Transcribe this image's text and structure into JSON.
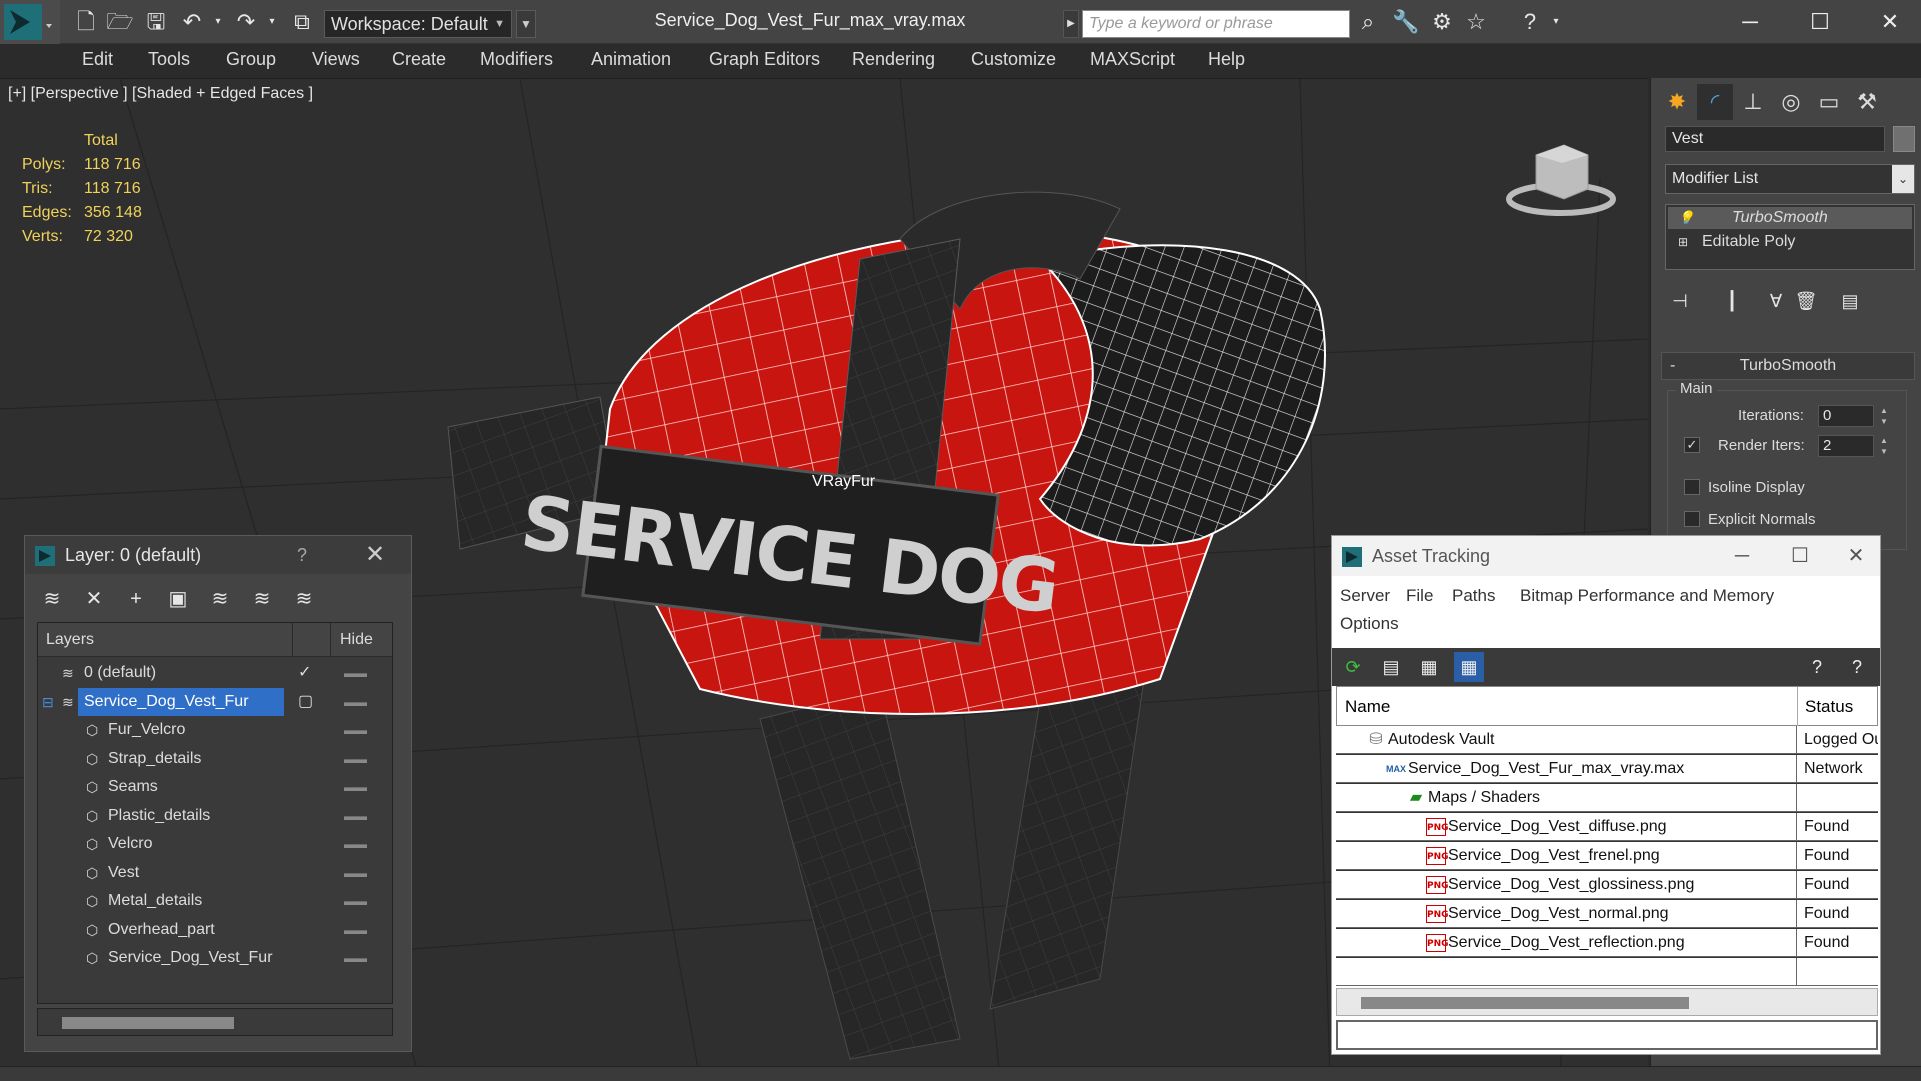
{
  "titlebar": {
    "workspace_label": "Workspace: Default",
    "document_title": "Service_Dog_Vest_Fur_max_vray.max",
    "search_placeholder": "Type a keyword or phrase"
  },
  "menu": [
    "Edit",
    "Tools",
    "Group",
    "Views",
    "Create",
    "Modifiers",
    "Animation",
    "Graph Editors",
    "Rendering",
    "Customize",
    "MAXScript",
    "Help"
  ],
  "viewport": {
    "label": "[+] [Perspective ] [Shaded + Edged Faces ]",
    "stats_header": "Total",
    "stats": [
      {
        "label": "Polys:",
        "value": "118 716"
      },
      {
        "label": "Tris:",
        "value": "118 716"
      },
      {
        "label": "Edges:",
        "value": "356 148"
      },
      {
        "label": "Verts:",
        "value": "72 320"
      }
    ],
    "object_label": "VRayFur",
    "patch_text": "SERVICE DOG",
    "accent_red": "#c8150f"
  },
  "command_panel": {
    "object_name": "Vest",
    "modifier_list": "Modifier List",
    "stack": [
      "TurboSmooth",
      "Editable Poly"
    ],
    "rollout_title": "TurboSmooth",
    "main_group": "Main",
    "iterations_label": "Iterations:",
    "iterations_value": "0",
    "render_iters_label": "Render Iters:",
    "render_iters_value": "2",
    "isoline_label": "Isoline Display",
    "explicit_normals_label": "Explicit Normals"
  },
  "layer_window": {
    "title": "Layer: 0 (default)",
    "help": "?",
    "col_layers": "Layers",
    "col_hide": "Hide",
    "rows": [
      {
        "name": "0 (default)",
        "type": "layer"
      },
      {
        "name": "Service_Dog_Vest_Fur",
        "type": "layer",
        "selected": true
      },
      {
        "name": "Fur_Velcro",
        "type": "object"
      },
      {
        "name": "Strap_details",
        "type": "object"
      },
      {
        "name": "Seams",
        "type": "object"
      },
      {
        "name": "Plastic_details",
        "type": "object"
      },
      {
        "name": "Velcro",
        "type": "object"
      },
      {
        "name": "Vest",
        "type": "object"
      },
      {
        "name": "Metal_details",
        "type": "object"
      },
      {
        "name": "Overhead_part",
        "type": "object"
      },
      {
        "name": "Service_Dog_Vest_Fur",
        "type": "object"
      }
    ]
  },
  "asset_window": {
    "title": "Asset Tracking",
    "menu": [
      "Server",
      "File",
      "Paths",
      "Bitmap Performance and Memory",
      "Options"
    ],
    "col_name": "Name",
    "col_status": "Status",
    "rows": [
      {
        "name": "Autodesk Vault",
        "status": "Logged Out",
        "indent": 1,
        "icon": "vault"
      },
      {
        "name": "Service_Dog_Vest_Fur_max_vray.max",
        "status": "Network",
        "indent": 2,
        "icon": "max"
      },
      {
        "name": "Maps / Shaders",
        "status": "",
        "indent": 3,
        "icon": "maps"
      },
      {
        "name": "Service_Dog_Vest_diffuse.png",
        "status": "Found",
        "indent": 4,
        "icon": "png"
      },
      {
        "name": "Service_Dog_Vest_frenel.png",
        "status": "Found",
        "indent": 4,
        "icon": "png"
      },
      {
        "name": "Service_Dog_Vest_glossiness.png",
        "status": "Found",
        "indent": 4,
        "icon": "png"
      },
      {
        "name": "Service_Dog_Vest_normal.png",
        "status": "Found",
        "indent": 4,
        "icon": "png"
      },
      {
        "name": "Service_Dog_Vest_reflection.png",
        "status": "Found",
        "indent": 4,
        "icon": "png"
      }
    ]
  }
}
